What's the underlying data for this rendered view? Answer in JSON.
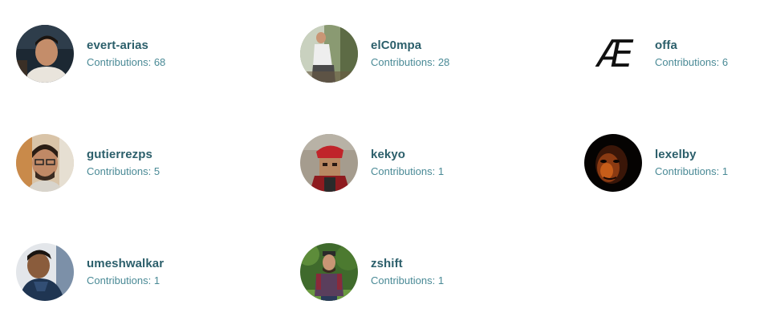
{
  "contributors": [
    {
      "username": "evert-arias",
      "contributions": "Contributions: 68",
      "avatar": "person-photo-dark-bg"
    },
    {
      "username": "elC0mpa",
      "contributions": "Contributions: 28",
      "avatar": "person-photo-outdoor"
    },
    {
      "username": "offa",
      "contributions": "Contributions: 6",
      "avatar": "ae-logo"
    },
    {
      "username": "gutierrezps",
      "contributions": "Contributions: 5",
      "avatar": "person-photo-glasses"
    },
    {
      "username": "kekyo",
      "contributions": "Contributions: 1",
      "avatar": "red-hat-character"
    },
    {
      "username": "lexelby",
      "contributions": "Contributions: 1",
      "avatar": "dark-face-photo"
    },
    {
      "username": "umeshwalkar",
      "contributions": "Contributions: 1",
      "avatar": "child-photo"
    },
    {
      "username": "zshift",
      "contributions": "Contributions: 1",
      "avatar": "person-photo-forest"
    }
  ],
  "offa_avatar_text": "Æ",
  "colors": {
    "username": "#2c5f6b",
    "contributions": "#4a8a96",
    "background": "#ffffff"
  }
}
